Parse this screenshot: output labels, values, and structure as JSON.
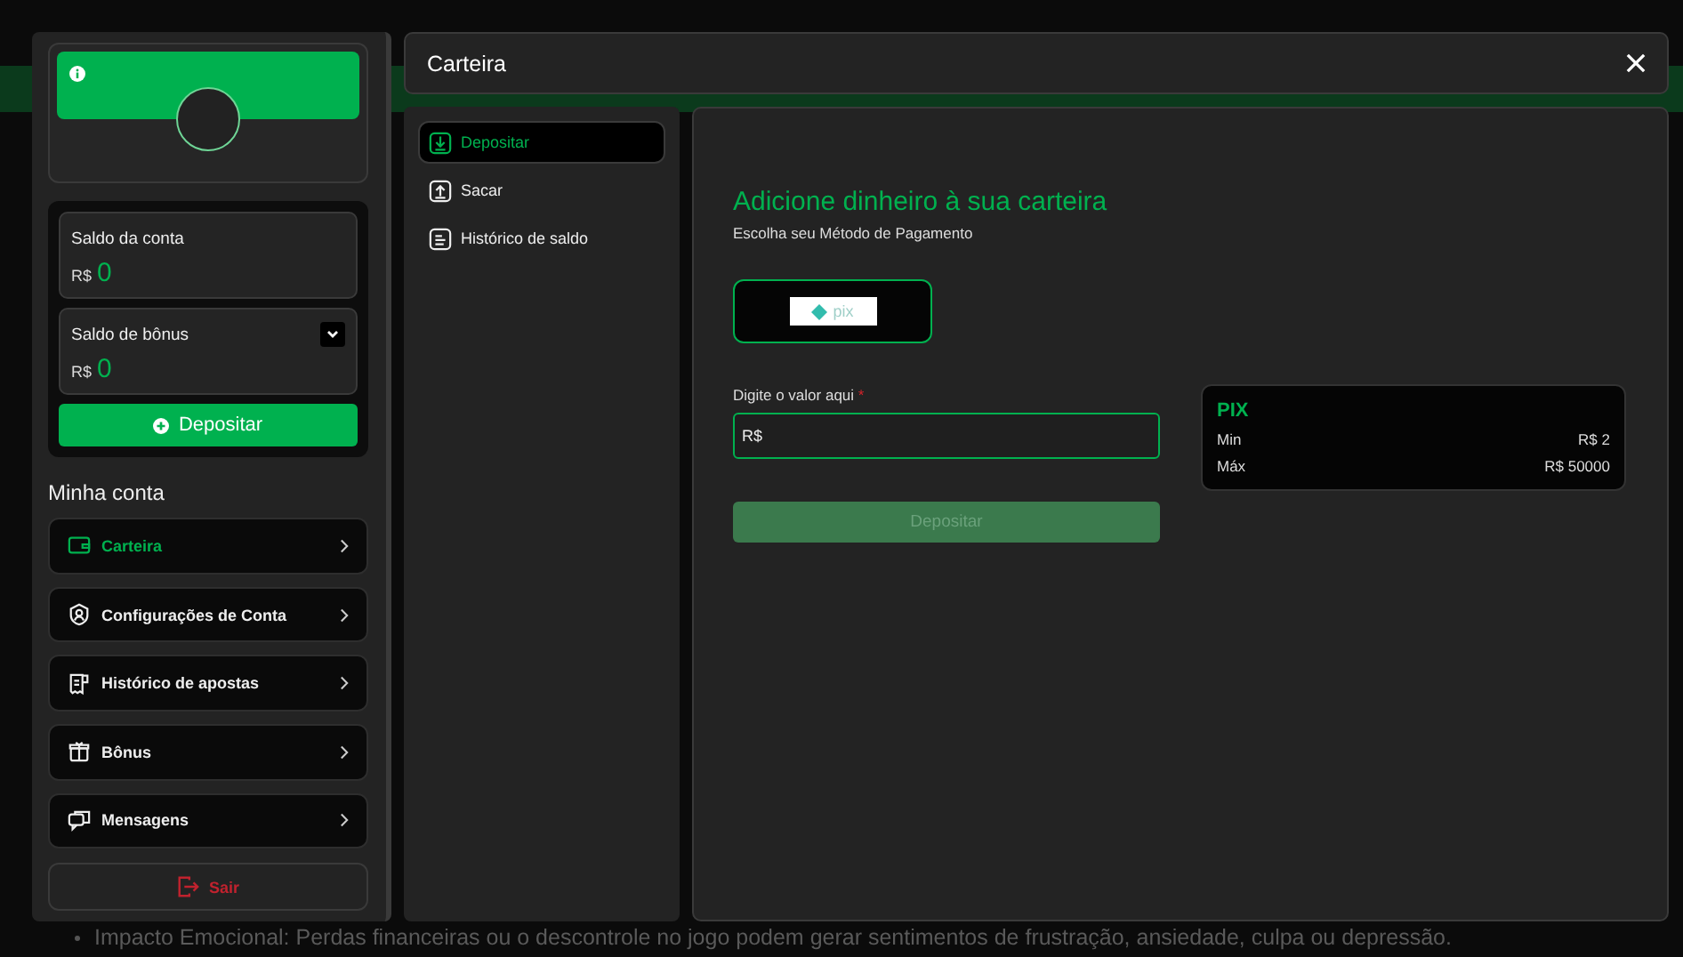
{
  "background_page": {
    "bullet_text": "Impacto Emocional: Perdas financeiras ou o descontrole no jogo podem gerar sentimentos de frustração, ansiedade, culpa ou depressão."
  },
  "account_panel": {
    "balances": [
      {
        "label": "Saldo da conta",
        "currency": "R$",
        "amount": "0",
        "expandable": false
      },
      {
        "label": "Saldo de bônus",
        "currency": "R$",
        "amount": "0",
        "expandable": true
      }
    ],
    "deposit_button": "Depositar",
    "section_title": "Minha conta",
    "menu": [
      {
        "label": "Carteira",
        "selected": true
      },
      {
        "label": "Configurações de Conta",
        "selected": false
      },
      {
        "label": "Histórico de apostas",
        "selected": false
      },
      {
        "label": "Bônus",
        "selected": false
      },
      {
        "label": "Mensagens",
        "selected": false
      }
    ],
    "logout": "Sair"
  },
  "wallet_modal": {
    "title": "Carteira",
    "tabs": [
      {
        "label": "Depositar",
        "selected": true
      },
      {
        "label": "Sacar",
        "selected": false
      },
      {
        "label": "Histórico de saldo",
        "selected": false
      }
    ],
    "heading": "Adicione dinheiro à sua carteira",
    "subheading": "Escolha seu Método de Pagamento",
    "methods": [
      {
        "label": "pix",
        "selected": true
      }
    ],
    "amount_field": {
      "label": "Digite o valor aqui",
      "required_mark": "*",
      "prefix": "R$"
    },
    "submit_button": {
      "label": "Depositar",
      "disabled": true
    },
    "limits": {
      "title": "PIX",
      "rows": [
        {
          "label": "Min",
          "value": "R$ 2"
        },
        {
          "label": "Máx",
          "value": "R$ 50000"
        }
      ]
    }
  }
}
